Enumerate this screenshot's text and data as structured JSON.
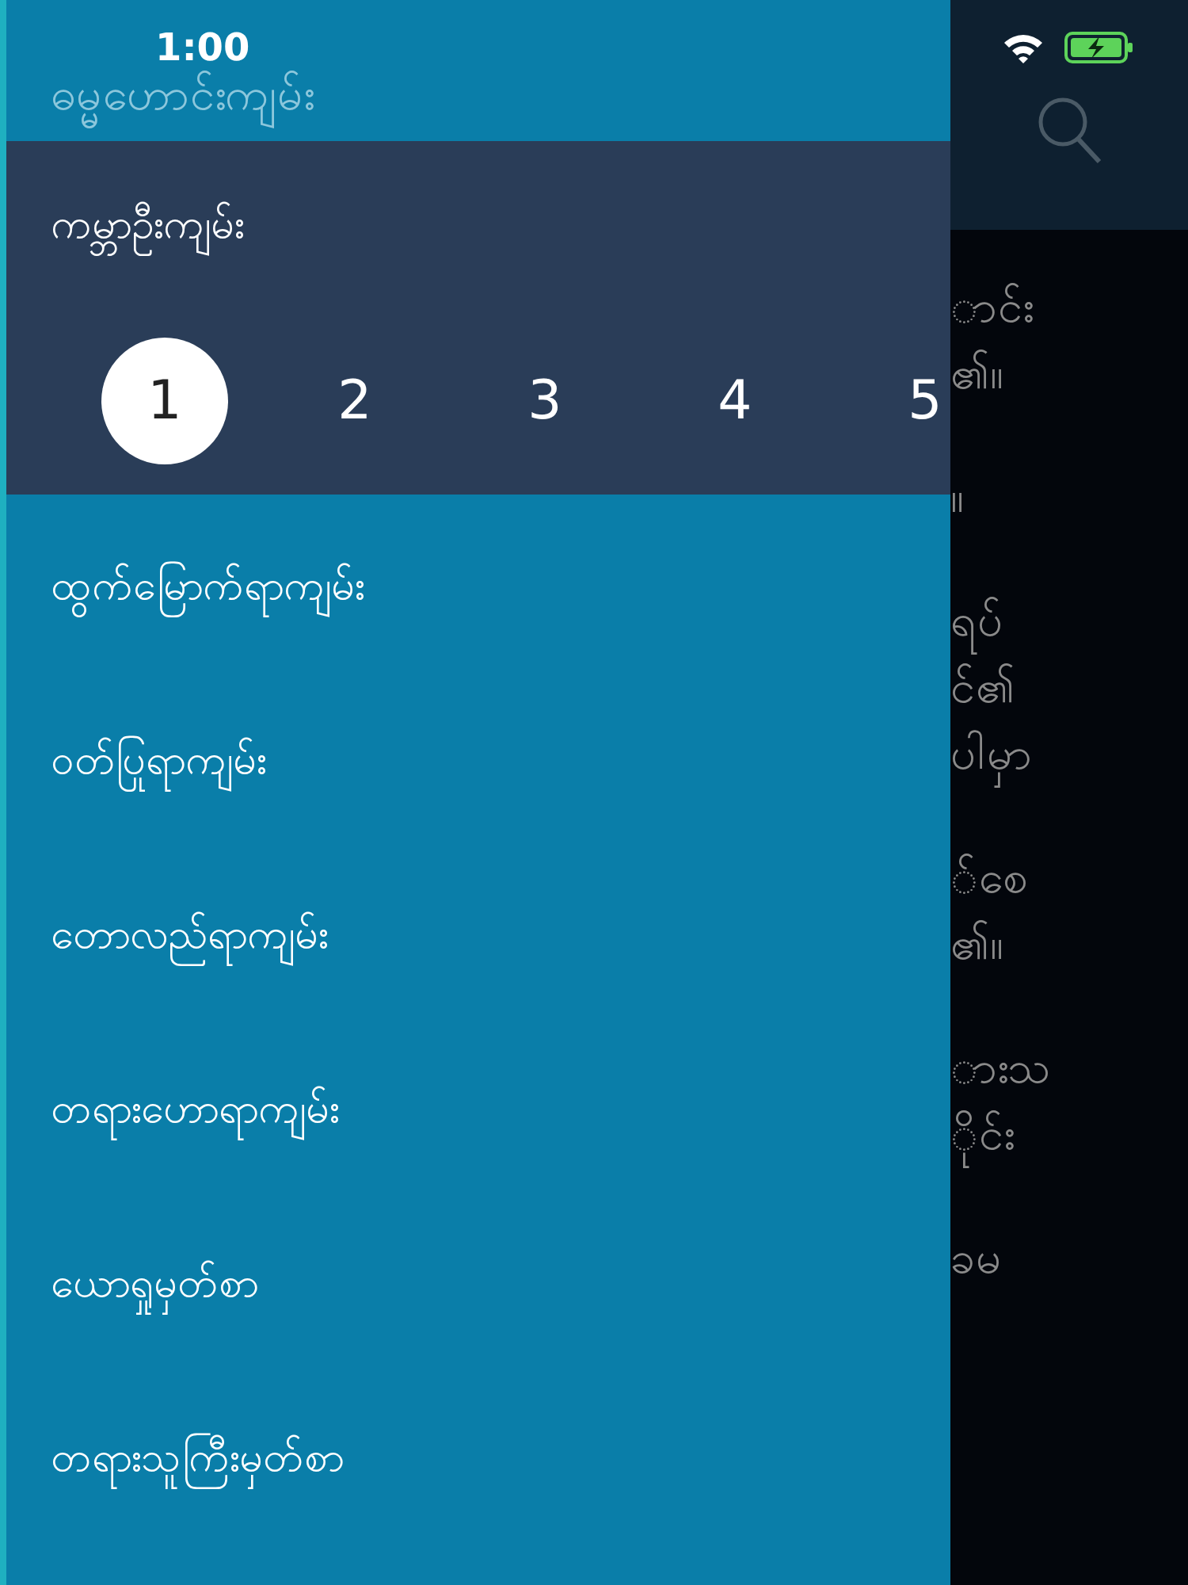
{
  "status_bar": {
    "time": "1:00"
  },
  "drawer": {
    "title": "ဓမ္မဟောင်းကျမ်း",
    "section": {
      "title": "ကမ္ဘာဦးကျမ်း",
      "pages": [
        {
          "label": "1",
          "selected": true
        },
        {
          "label": "2",
          "selected": false
        },
        {
          "label": "3",
          "selected": false
        },
        {
          "label": "4",
          "selected": false
        },
        {
          "label": "5",
          "selected": false
        }
      ]
    },
    "items": [
      "ထွက်မြောက်ရာကျမ်း",
      "ဝတ်ပြုရာကျမ်း",
      "တောလည်ရာကျမ်း",
      "တရားဟောရာကျမ်း",
      "ယောရှုမှတ်စာ",
      "တရားသူကြီးမှတ်စာ"
    ]
  },
  "reader": {
    "paragraphs": [
      [
        "ာင်း",
        "၏။"
      ],
      [
        "။"
      ],
      [
        "ရပ်",
        "င်၏",
        "ပါမှာ"
      ],
      [
        "်စေ",
        "၏။"
      ],
      [
        "ားသ",
        "ိုင်း"
      ],
      [
        "ခမ"
      ]
    ]
  }
}
